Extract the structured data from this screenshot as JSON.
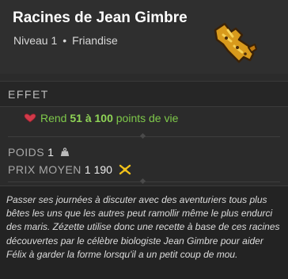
{
  "item": {
    "name": "Racines de Jean Gimbre",
    "level": "Niveau 1",
    "separator": "•",
    "category": "Friandise"
  },
  "effects": {
    "header": "EFFET",
    "line": {
      "prefix": "Rend",
      "min": "51",
      "connector": "à",
      "max": "100",
      "suffix": "points de vie"
    }
  },
  "stats": {
    "weight_label": "POIDS",
    "weight_value": "1",
    "price_label": "PRIX MOYEN",
    "price_value": "1 190"
  },
  "description": "Passer ses journées à discuter avec des aventuriers tous plus bêtes les uns que les autres peut ramollir même le plus endurci des maris. Zézette utilise donc une recette à base de ces racines découvertes par le célèbre biologiste Jean Gimbre pour aider Félix à garder la forme lorsqu'il a un petit coup de mou.",
  "colors": {
    "effect_value": "#8fd456",
    "heart": "#d23a4a",
    "kama": "#f2c21a"
  },
  "icons": [
    "ginger-root-item-icon",
    "heart-icon",
    "weight-icon",
    "kama-icon"
  ]
}
